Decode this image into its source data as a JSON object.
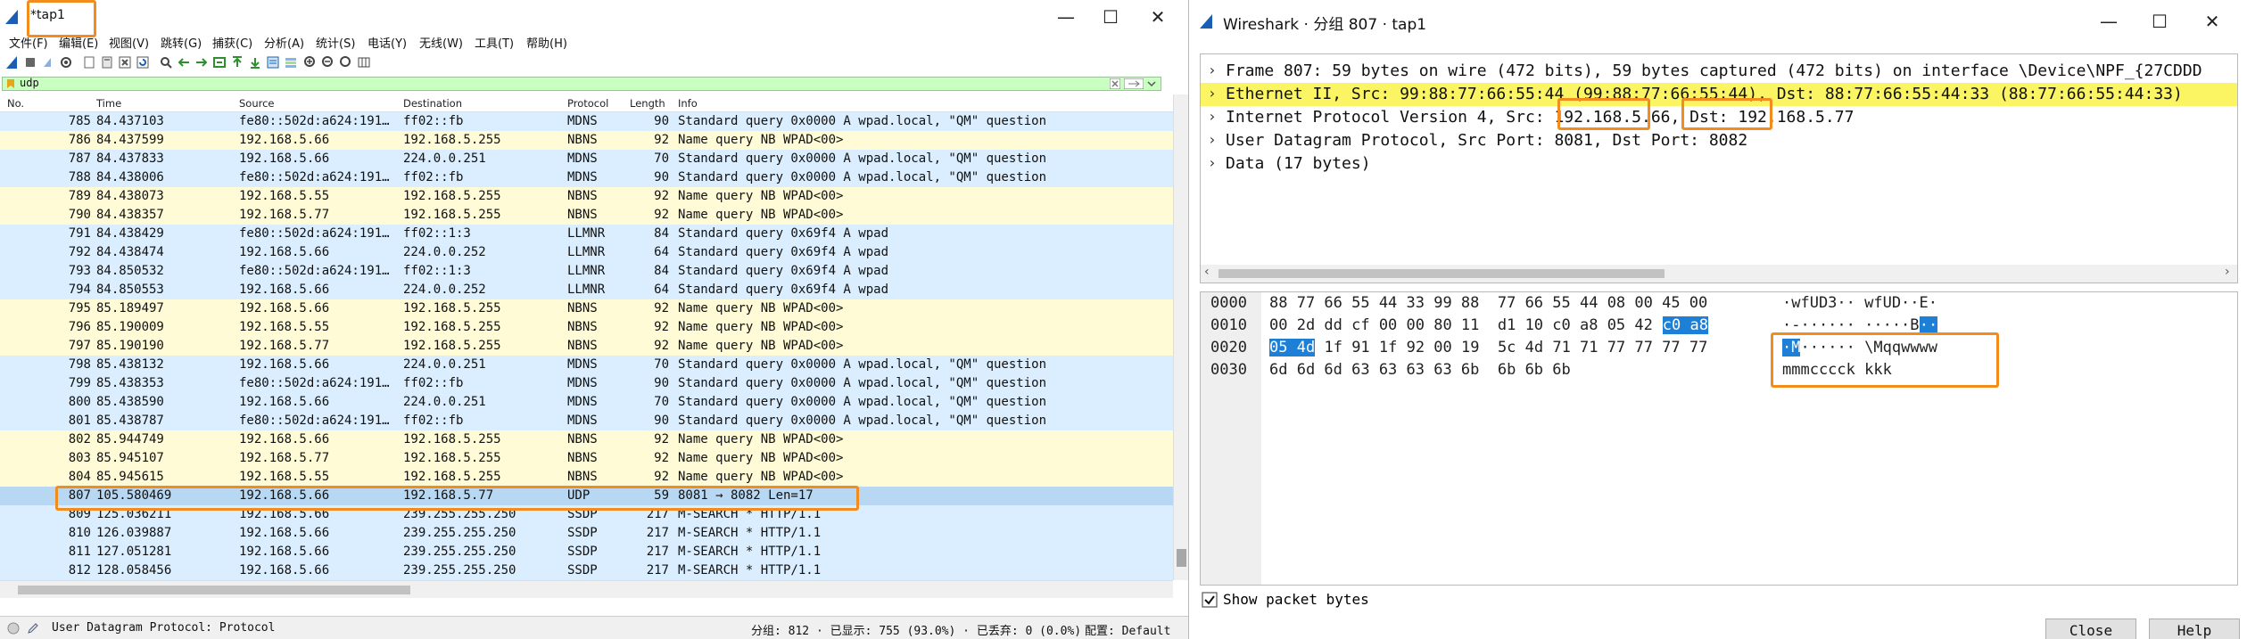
{
  "left": {
    "title": "*tap1",
    "controls": {
      "minimize": "—",
      "maximize": "☐",
      "close": "✕"
    },
    "menu": [
      "文件(F)",
      "编辑(E)",
      "视图(V)",
      "跳转(G)",
      "捕获(C)",
      "分析(A)",
      "统计(S)",
      "电话(Y)",
      "无线(W)",
      "工具(T)",
      "帮助(H)"
    ],
    "filter": {
      "value": "udp"
    },
    "columns": [
      "No.",
      "Time",
      "Source",
      "Destination",
      "Protocol",
      "Length",
      "Info"
    ],
    "packets": [
      {
        "no": "785",
        "time": "84.437103",
        "src": "fe80::502d:a624:191…",
        "dst": "ff02::fb",
        "proto": "MDNS",
        "len": "90",
        "info": "Standard query 0x0000 A wpad.local, \"QM\" question",
        "kind": "mdns"
      },
      {
        "no": "786",
        "time": "84.437599",
        "src": "192.168.5.66",
        "dst": "192.168.5.255",
        "proto": "NBNS",
        "len": "92",
        "info": "Name query NB WPAD<00>",
        "kind": "nbns"
      },
      {
        "no": "787",
        "time": "84.437833",
        "src": "192.168.5.66",
        "dst": "224.0.0.251",
        "proto": "MDNS",
        "len": "70",
        "info": "Standard query 0x0000 A wpad.local, \"QM\" question",
        "kind": "mdns"
      },
      {
        "no": "788",
        "time": "84.438006",
        "src": "fe80::502d:a624:191…",
        "dst": "ff02::fb",
        "proto": "MDNS",
        "len": "90",
        "info": "Standard query 0x0000 A wpad.local, \"QM\" question",
        "kind": "mdns"
      },
      {
        "no": "789",
        "time": "84.438073",
        "src": "192.168.5.55",
        "dst": "192.168.5.255",
        "proto": "NBNS",
        "len": "92",
        "info": "Name query NB WPAD<00>",
        "kind": "nbns"
      },
      {
        "no": "790",
        "time": "84.438357",
        "src": "192.168.5.77",
        "dst": "192.168.5.255",
        "proto": "NBNS",
        "len": "92",
        "info": "Name query NB WPAD<00>",
        "kind": "nbns"
      },
      {
        "no": "791",
        "time": "84.438429",
        "src": "fe80::502d:a624:191…",
        "dst": "ff02::1:3",
        "proto": "LLMNR",
        "len": "84",
        "info": "Standard query 0x69f4 A wpad",
        "kind": "llmnr"
      },
      {
        "no": "792",
        "time": "84.438474",
        "src": "192.168.5.66",
        "dst": "224.0.0.252",
        "proto": "LLMNR",
        "len": "64",
        "info": "Standard query 0x69f4 A wpad",
        "kind": "llmnr"
      },
      {
        "no": "793",
        "time": "84.850532",
        "src": "fe80::502d:a624:191…",
        "dst": "ff02::1:3",
        "proto": "LLMNR",
        "len": "84",
        "info": "Standard query 0x69f4 A wpad",
        "kind": "llmnr"
      },
      {
        "no": "794",
        "time": "84.850553",
        "src": "192.168.5.66",
        "dst": "224.0.0.252",
        "proto": "LLMNR",
        "len": "64",
        "info": "Standard query 0x69f4 A wpad",
        "kind": "llmnr"
      },
      {
        "no": "795",
        "time": "85.189497",
        "src": "192.168.5.66",
        "dst": "192.168.5.255",
        "proto": "NBNS",
        "len": "92",
        "info": "Name query NB WPAD<00>",
        "kind": "nbns"
      },
      {
        "no": "796",
        "time": "85.190009",
        "src": "192.168.5.55",
        "dst": "192.168.5.255",
        "proto": "NBNS",
        "len": "92",
        "info": "Name query NB WPAD<00>",
        "kind": "nbns"
      },
      {
        "no": "797",
        "time": "85.190190",
        "src": "192.168.5.77",
        "dst": "192.168.5.255",
        "proto": "NBNS",
        "len": "92",
        "info": "Name query NB WPAD<00>",
        "kind": "nbns"
      },
      {
        "no": "798",
        "time": "85.438132",
        "src": "192.168.5.66",
        "dst": "224.0.0.251",
        "proto": "MDNS",
        "len": "70",
        "info": "Standard query 0x0000 A wpad.local, \"QM\" question",
        "kind": "mdns"
      },
      {
        "no": "799",
        "time": "85.438353",
        "src": "fe80::502d:a624:191…",
        "dst": "ff02::fb",
        "proto": "MDNS",
        "len": "90",
        "info": "Standard query 0x0000 A wpad.local, \"QM\" question",
        "kind": "mdns"
      },
      {
        "no": "800",
        "time": "85.438590",
        "src": "192.168.5.66",
        "dst": "224.0.0.251",
        "proto": "MDNS",
        "len": "70",
        "info": "Standard query 0x0000 A wpad.local, \"QM\" question",
        "kind": "mdns"
      },
      {
        "no": "801",
        "time": "85.438787",
        "src": "fe80::502d:a624:191…",
        "dst": "ff02::fb",
        "proto": "MDNS",
        "len": "90",
        "info": "Standard query 0x0000 A wpad.local, \"QM\" question",
        "kind": "mdns"
      },
      {
        "no": "802",
        "time": "85.944749",
        "src": "192.168.5.66",
        "dst": "192.168.5.255",
        "proto": "NBNS",
        "len": "92",
        "info": "Name query NB WPAD<00>",
        "kind": "nbns"
      },
      {
        "no": "803",
        "time": "85.945107",
        "src": "192.168.5.77",
        "dst": "192.168.5.255",
        "proto": "NBNS",
        "len": "92",
        "info": "Name query NB WPAD<00>",
        "kind": "nbns"
      },
      {
        "no": "804",
        "time": "85.945615",
        "src": "192.168.5.55",
        "dst": "192.168.5.255",
        "proto": "NBNS",
        "len": "92",
        "info": "Name query NB WPAD<00>",
        "kind": "nbns"
      },
      {
        "no": "807",
        "time": "105.580469",
        "src": "192.168.5.66",
        "dst": "192.168.5.77",
        "proto": "UDP",
        "len": "59",
        "info": "8081 → 8082 Len=17",
        "kind": "udp"
      },
      {
        "no": "809",
        "time": "125.036211",
        "src": "192.168.5.66",
        "dst": "239.255.255.250",
        "proto": "SSDP",
        "len": "217",
        "info": "M-SEARCH * HTTP/1.1",
        "kind": "ssdp"
      },
      {
        "no": "810",
        "time": "126.039887",
        "src": "192.168.5.66",
        "dst": "239.255.255.250",
        "proto": "SSDP",
        "len": "217",
        "info": "M-SEARCH * HTTP/1.1",
        "kind": "ssdp"
      },
      {
        "no": "811",
        "time": "127.051281",
        "src": "192.168.5.66",
        "dst": "239.255.255.250",
        "proto": "SSDP",
        "len": "217",
        "info": "M-SEARCH * HTTP/1.1",
        "kind": "ssdp"
      },
      {
        "no": "812",
        "time": "128.058456",
        "src": "192.168.5.66",
        "dst": "239.255.255.250",
        "proto": "SSDP",
        "len": "217",
        "info": "M-SEARCH * HTTP/1.1",
        "kind": "ssdp"
      }
    ],
    "status": {
      "field": "User Datagram Protocol: Protocol",
      "groups": "分组: 812 · 已显示: 755 (93.0%) · 已丢弃: 0 (0.0%)",
      "profile": "配置: Default"
    }
  },
  "right": {
    "title": "Wireshark · 分组 807 · tap1",
    "controls": {
      "minimize": "—",
      "maximize": "☐",
      "close": "✕"
    },
    "tree": [
      {
        "arrow": "›",
        "text": "Frame 807: 59 bytes on wire (472 bits), 59 bytes captured (472 bits) on interface \\Device\\NPF_{27CDDD",
        "highlight": false
      },
      {
        "arrow": "›",
        "text": "Ethernet II, Src: 99:88:77:66:55:44 (99:88:77:66:55:44), Dst: 88:77:66:55:44:33 (88:77:66:55:44:33)",
        "highlight": true
      },
      {
        "arrow": "›",
        "text": "Internet Protocol Version 4, Src: 192.168.5.66, Dst: 192.168.5.77",
        "highlight": false
      },
      {
        "arrow": "›",
        "text": "User Datagram Protocol, Src Port: 8081, Dst Port: 8082",
        "highlight": false
      },
      {
        "arrow": "›",
        "text": "Data (17 bytes)",
        "highlight": false
      }
    ],
    "bytes": [
      {
        "offset": "0000",
        "hex_a": "88 77 66 55 44 33 99 88  77 66 55 44 08 00 45 00",
        "hex_sel": "",
        "ascii_a": "·wfUD3·· wfUD··E·",
        "ascii_sel": ""
      },
      {
        "offset": "0010",
        "hex_a": "00 2d dd cf 00 00 80 11  d1 10 c0 a8 05 42 ",
        "hex_sel": "c0 a8",
        "ascii_a": "·-······ ·····B",
        "ascii_sel": "··"
      },
      {
        "offset": "0020",
        "hex_sel_pre": "05 4d",
        "hex_a": " 1f 91 1f 92 00 19  5c 4d 71 71 77 77 77 77",
        "ascii_sel_pre": "·M",
        "ascii_a": "······ \\Mqqwwww"
      },
      {
        "offset": "0030",
        "hex_a": "6d 6d 6d 63 63 63 63 6b  6b 6b 6b",
        "ascii_a": "mmmcccck kkk"
      }
    ],
    "show_bytes_label": "Show packet bytes",
    "buttons": {
      "close": "Close",
      "help": "Help"
    }
  }
}
